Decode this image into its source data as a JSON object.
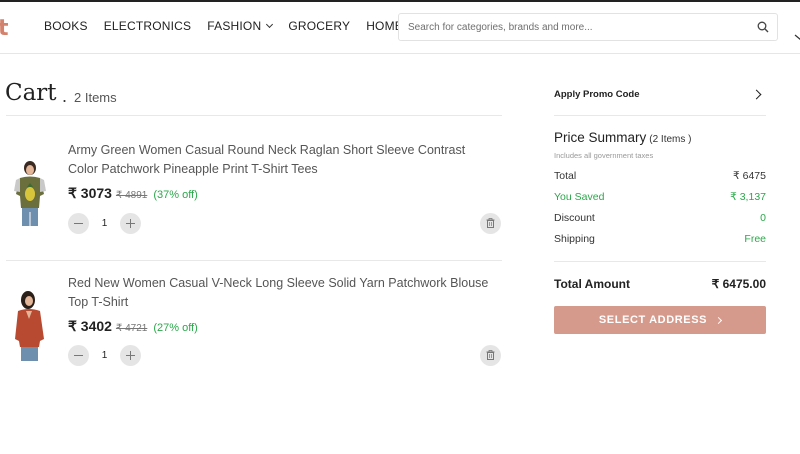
{
  "header": {
    "logo_text": "t",
    "nav": [
      {
        "label": "BOOKS"
      },
      {
        "label": "ELECTRONICS"
      },
      {
        "label": "FASHION"
      },
      {
        "label": "GROCERY"
      },
      {
        "label": "HOME"
      }
    ],
    "search": {
      "placeholder": "Search for categories, brands and more...",
      "value": ""
    },
    "search_icon": "search-icon"
  },
  "cart": {
    "title": "Cart",
    "dot": ".",
    "count_label": "2 Items",
    "items": [
      {
        "title": "Army Green Women Casual Round Neck Raglan Short Sleeve Contrast Color Patchwork Pineapple Print T-Shirt Tees",
        "price": "₹ 3073",
        "mrp": "₹ 4891",
        "discount": "(37% off)",
        "quantity": "1",
        "image": "army-green-tshirt-image"
      },
      {
        "title": "Red New Women Casual V-Neck Long Sleeve Solid Yarn Patchwork Blouse Top T-Shirt",
        "price": "₹ 3402",
        "mrp": "₹ 4721",
        "discount": "(27% off)",
        "quantity": "1",
        "image": "red-blouse-image"
      }
    ]
  },
  "summary": {
    "promo_label": "Apply Promo Code",
    "title": "Price Summary",
    "count": "(2 Items )",
    "subtitle": "Includes all government taxes",
    "rows": [
      {
        "label": "Total",
        "value": "₹ 6475"
      },
      {
        "label": "You Saved",
        "value": "₹ 3,137"
      },
      {
        "label": "Discount",
        "value": "0"
      },
      {
        "label": "Shipping",
        "value": "Free"
      }
    ],
    "total_label": "Total Amount",
    "total_value": "₹ 6475.00",
    "select_button": "SELECT ADDRESS"
  },
  "colors": {
    "brand": "#d4826d",
    "button": "#d59a8b",
    "success": "#2aa84a"
  }
}
